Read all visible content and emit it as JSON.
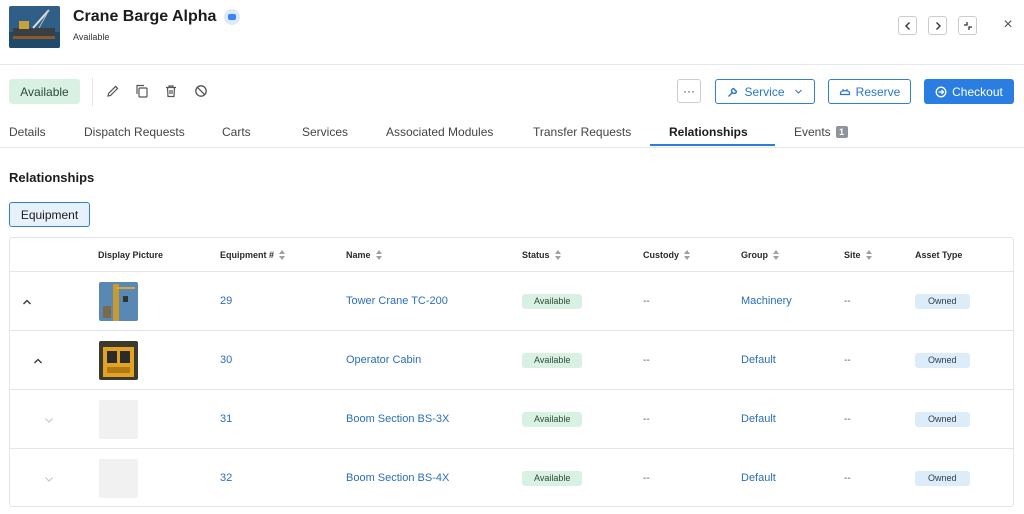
{
  "header": {
    "title": "Crane Barge Alpha",
    "subtitle": "Available"
  },
  "toolbar": {
    "status_label": "Available",
    "more_label": "···",
    "service_label": "Service",
    "reserve_label": "Reserve",
    "checkout_label": "Checkout"
  },
  "tabs": [
    {
      "label": "Details"
    },
    {
      "label": "Dispatch Requests"
    },
    {
      "label": "Carts"
    },
    {
      "label": "Services"
    },
    {
      "label": "Associated Modules"
    },
    {
      "label": "Transfer Requests"
    },
    {
      "label": "Relationships",
      "active": true
    },
    {
      "label": "Events",
      "count": "1"
    }
  ],
  "section": {
    "title": "Relationships",
    "chip_label": "Equipment"
  },
  "table": {
    "columns": {
      "display_picture": "Display Picture",
      "equipment_no": "Equipment #",
      "name": "Name",
      "status": "Status",
      "custody": "Custody",
      "group": "Group",
      "site": "Site",
      "asset_type": "Asset Type"
    },
    "rows": [
      {
        "equipment_no": "29",
        "name": "Tower Crane TC-200",
        "status": "Available",
        "custody": "--",
        "group": "Machinery",
        "site": "--",
        "asset_type": "Owned",
        "chevron": "chevron-up-icon"
      },
      {
        "equipment_no": "30",
        "name": "Operator Cabin",
        "status": "Available",
        "custody": "--",
        "group": "Default",
        "site": "--",
        "asset_type": "Owned",
        "chevron": "chevron-up-icon"
      },
      {
        "equipment_no": "31",
        "name": "Boom Section BS-3X",
        "status": "Available",
        "custody": "--",
        "group": "Default",
        "site": "--",
        "asset_type": "Owned",
        "chevron": "chevron-down-icon"
      },
      {
        "equipment_no": "32",
        "name": "Boom Section BS-4X",
        "status": "Available",
        "custody": "--",
        "group": "Default",
        "site": "--",
        "asset_type": "Owned",
        "chevron": "chevron-down-icon"
      }
    ]
  },
  "colors": {
    "accent": "#2a7de1",
    "status_bg": "#d9f1e2",
    "owned_bg": "#dcecf8"
  }
}
